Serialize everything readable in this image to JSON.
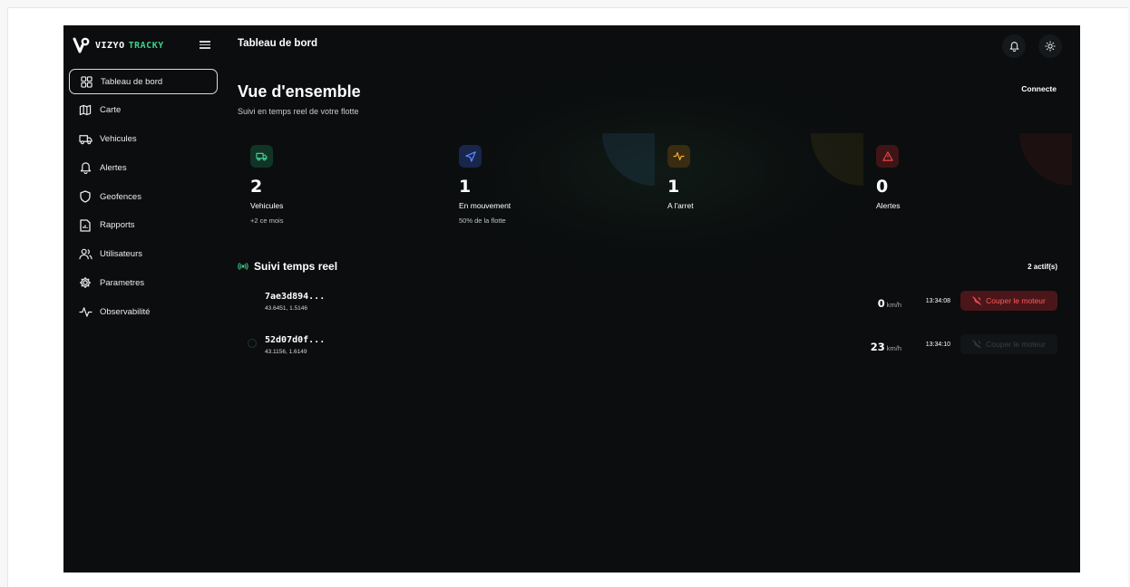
{
  "app": {
    "brand": "VIZYO",
    "brand_accent": "TRACKY",
    "header_title": "Tableau de bord"
  },
  "sidebar": {
    "items": [
      {
        "label": "Tableau de bord",
        "icon": "dashboard-icon",
        "active": true
      },
      {
        "label": "Carte",
        "icon": "map-icon"
      },
      {
        "label": "Vehicules",
        "icon": "truck-icon"
      },
      {
        "label": "Alertes",
        "icon": "bell-icon"
      },
      {
        "label": "Geofences",
        "icon": "shield-icon"
      },
      {
        "label": "Rapports",
        "icon": "report-icon"
      },
      {
        "label": "Utilisateurs",
        "icon": "users-icon"
      },
      {
        "label": "Parametres",
        "icon": "gear-icon"
      },
      {
        "label": "Observabilité",
        "icon": "activity-icon"
      }
    ]
  },
  "overview": {
    "title": "Vue d'ensemble",
    "subtitle": "Suivi en temps reel de votre flotte",
    "status": "Connecte"
  },
  "stats": [
    {
      "value": "2",
      "label": "Vehicules",
      "sub": "+2 ce mois",
      "icon": "truck-icon",
      "color": "#3ecf8e"
    },
    {
      "value": "1",
      "label": "En mouvement",
      "sub": "50% de la flotte",
      "icon": "navigation-icon",
      "color": "#5b8cff"
    },
    {
      "value": "1",
      "label": "A l'arret",
      "sub": "",
      "icon": "activity-icon",
      "color": "#f0b13a"
    },
    {
      "value": "0",
      "label": "Alertes",
      "sub": "",
      "icon": "alert-triangle-icon",
      "color": "#ef4444"
    }
  ],
  "tracking": {
    "title": "Suivi temps reel",
    "active_count": "2 actif(s)",
    "speed_unit": "km/h",
    "vehicles": [
      {
        "id": "7ae3d894...",
        "coords": "43.6451, 1.5146",
        "speed": "0",
        "time": "13:34:08",
        "action": "Couper le moteur",
        "action_enabled": true
      },
      {
        "id": "52d07d0f...",
        "coords": "43.1156, 1.6149",
        "speed": "23",
        "time": "13:34:10",
        "action": "Couper le moteur",
        "action_enabled": false
      }
    ]
  }
}
